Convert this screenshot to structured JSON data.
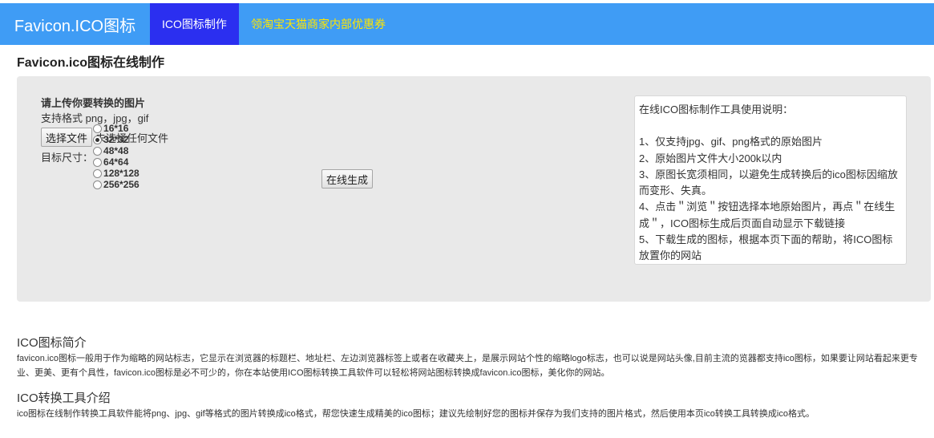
{
  "navbar": {
    "brand": "Favicon.ICO图标",
    "active_item": "ICO图标制作",
    "promo_item": "领淘宝天猫商家内部优惠券"
  },
  "page_title": "Favicon.ico图标在线制作",
  "upload": {
    "heading": "请上传你要转换的图片",
    "formats": "支持格式 png，jpg，gif",
    "choose_file_label": "选择文件",
    "file_status": "未选择任何文件",
    "size_label": "目标尺寸：",
    "sizes": [
      "16*16",
      "32*32",
      "48*48",
      "64*64",
      "128*128",
      "256*256"
    ],
    "selected_size": "32*32",
    "generate_label": "在线生成"
  },
  "help": {
    "title": "在线ICO图标制作工具使用说明：",
    "items": [
      "1、仅支持jpg、gif、png格式的原始图片",
      "2、原始图片文件大小200k以内",
      "3、原图长宽须相同，以避免生成转换后的ico图标因缩放而变形、失真。",
      "4、点击＂浏览＂按钮选择本地原始图片，再点＂在线生成＂，ICO图标生成后页面自动显示下载链接",
      "5、下载生成的图标，根据本页下面的帮助，将ICO图标放置你的网站"
    ]
  },
  "intro": {
    "title": "ICO图标简介",
    "text": "favicon.ico图标一般用于作为缩略的网站标志，它显示在浏览器的标题栏、地址栏、左边浏览器标签上或者在收藏夹上，是展示网站个性的缩略logo标志，也可以说是网站头像,目前主流的览器都支持ico图标，如果要让网站看起来更专业、更美、更有个具性，favicon.ico图标是必不可少的，你在本站使用ICO图标转换工具软件可以轻松将网站图标转换成favicon.ico图标，美化你的网站。"
  },
  "tool_intro": {
    "title": "ICO转换工具介绍",
    "text": "ico图标在线制作转换工具软件能将png、jpg、gif等格式的图片转换成ico格式，帮您快速生成精美的ico图标；建议先绘制好您的图标并保存为我们支持的图片格式，然后使用本页ico转换工具转换成ico格式。"
  }
}
